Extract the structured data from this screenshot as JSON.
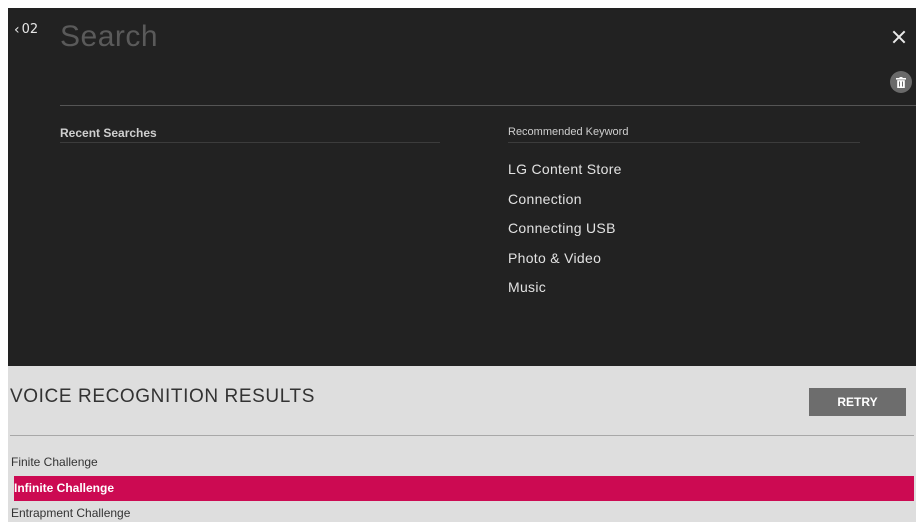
{
  "header": {
    "back_label": "02",
    "search_placeholder": "Search"
  },
  "recent": {
    "heading": "Recent Searches"
  },
  "recommended": {
    "heading": "Recommended Keyword",
    "items": [
      "LG Content Store",
      "Connection",
      "Connecting USB",
      "Photo & Video",
      "Music"
    ]
  },
  "voice": {
    "title": "VOICE RECOGNITION RESULTS",
    "retry_label": "RETRY",
    "results": [
      "Finite Challenge",
      "Infinite Challenge",
      "Entrapment Challenge"
    ],
    "selected_index": 1
  },
  "colors": {
    "background": "#222222",
    "voice_panel": "#dedede",
    "selection": "#cc0a52",
    "retry_button": "#6d6d6d"
  },
  "icons": [
    "chevron-left-icon",
    "close-icon",
    "trash-icon"
  ]
}
